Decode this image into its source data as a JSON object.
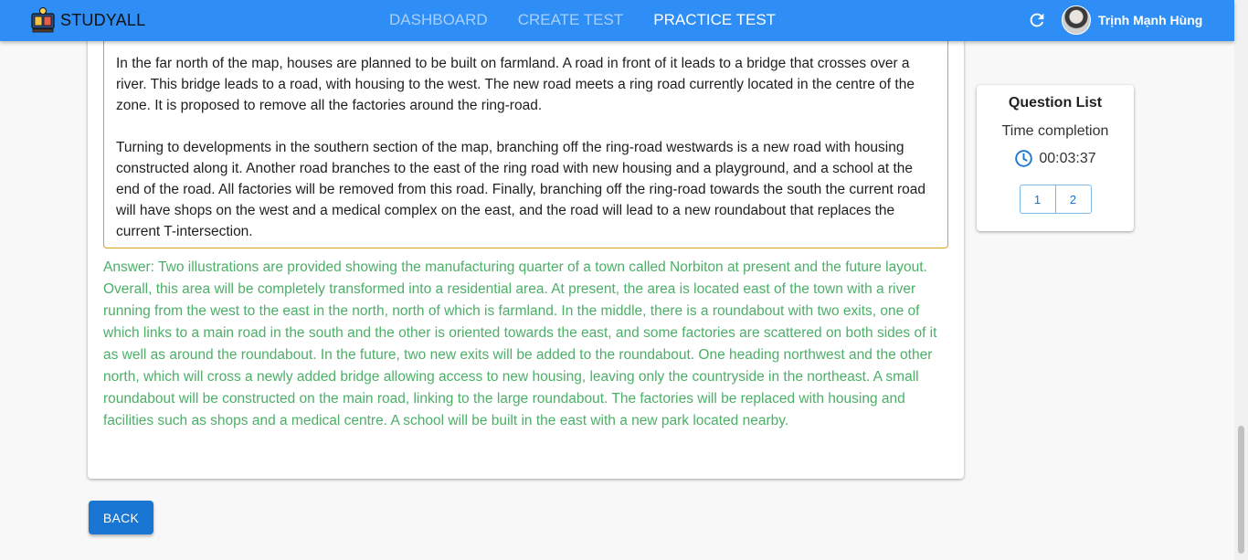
{
  "header": {
    "brand": "STUDYALL",
    "nav": [
      {
        "label": "DASHBOARD"
      },
      {
        "label": "CREATE TEST"
      },
      {
        "label": "PRACTICE TEST"
      }
    ],
    "user_name": "Trịnh Mạnh Hùng",
    "icons": {
      "logo": "study-logo-icon",
      "refresh": "refresh-icon",
      "avatar": "user-avatar"
    },
    "colors": {
      "bar": "#2e8ef5",
      "nav_inactive": "#a9cff8",
      "nav_active": "#ffffff"
    }
  },
  "question": {
    "paragraphs": [
      "In the far north of the map, houses are planned to be built on farmland. A road in front of it leads to a bridge that crosses over a river. This bridge leads to a road, with housing to the west. The new road meets a ring road currently located in the centre of the zone. It is proposed to remove all the factories around the ring-road.",
      "Turning to developments in the southern section of the map, branching off the ring-road westwards is a new road with housing constructed along it. Another road branches to the east of the ring road with new housing and a playground, and a school at the end of the road. All factories will be removed from this road. Finally, branching off the ring-road towards the south the current road will have shops on the west and a medical complex on the east, and the road will lead to a new roundabout that replaces the current T-intersection."
    ]
  },
  "answer": {
    "text": "Answer: Two illustrations are provided showing the manufacturing quarter of a town called Norbiton at present and the future layout. Overall, this area will be completely transformed into a residential area. At present, the area is located east of the town with a river running from the west to the east in the north, north of which is farmland. In the middle, there is a roundabout with two exits, one of which links to a main road in the south and the other is oriented towards the east, and some factories are scattered on both sides of it as well as around the roundabout. In the future, two new exits will be added to the roundabout. One heading northwest and the other north, which will cross a newly added bridge allowing access to new housing, leaving only the countryside in the northeast. A small roundabout will be constructed on the main road, linking to the large roundabout. The factories will be replaced with housing and facilities such as shops and a medical centre. A school will be built in the east with a new park located nearby.",
    "color": "#4caf68"
  },
  "back_button": {
    "label": "BACK",
    "color": "#1976d2"
  },
  "question_list": {
    "title": "Question List",
    "time_label": "Time completion",
    "time_value": "00:03:37",
    "icon": "clock-icon",
    "questions": [
      "1",
      "2"
    ]
  }
}
